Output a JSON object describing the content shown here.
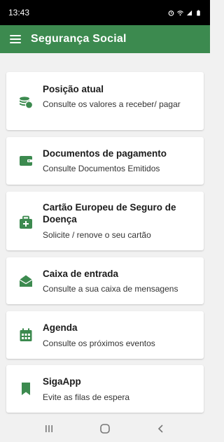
{
  "status_bar": {
    "time": "13:43"
  },
  "app_bar": {
    "title": "Segurança Social"
  },
  "cards": [
    {
      "title": "Posição atual",
      "subtitle": "Consulte os valores a receber/ pagar",
      "icon": "coins-icon"
    },
    {
      "title": "Documentos de pagamento",
      "subtitle": "Consulte Documentos Emitidos",
      "icon": "wallet-icon"
    },
    {
      "title": "Cartão Europeu de Seguro de Doença",
      "subtitle": "Solicite / renove o seu cartão",
      "icon": "medical-kit-icon"
    },
    {
      "title": "Caixa de entrada",
      "subtitle": "Consulte a sua caixa de mensagens",
      "icon": "open-envelope-icon"
    },
    {
      "title": "Agenda",
      "subtitle": "Consulte os próximos eventos",
      "icon": "calendar-icon"
    },
    {
      "title": "SigaApp",
      "subtitle": "Evite as filas de espera",
      "icon": "bookmark-icon"
    }
  ],
  "colors": {
    "brand": "#3c8a4f",
    "background": "#f1f1f1"
  }
}
